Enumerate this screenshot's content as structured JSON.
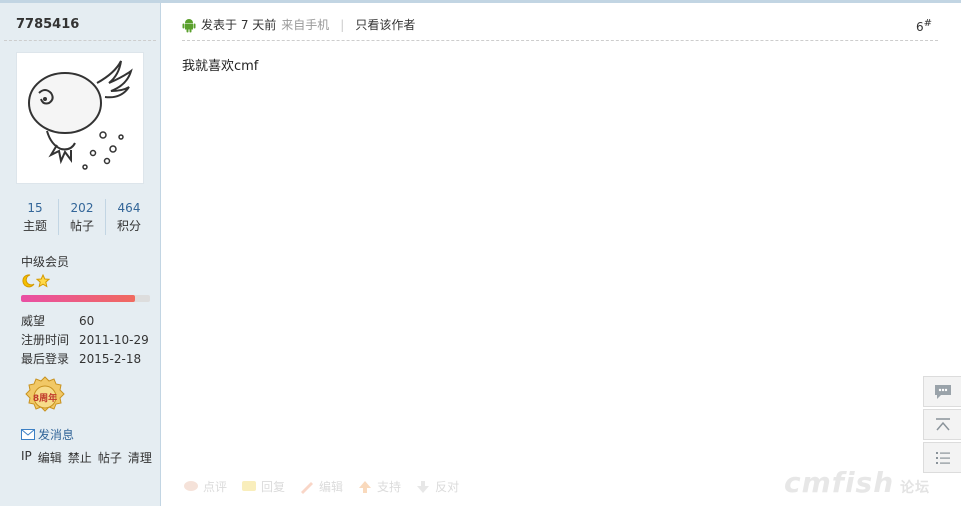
{
  "user": {
    "name": "7785416",
    "stats": [
      {
        "num": "15",
        "label": "主题"
      },
      {
        "num": "202",
        "label": "帖子"
      },
      {
        "num": "464",
        "label": "积分"
      }
    ],
    "group": "中级会员",
    "progress": 0.88,
    "info": [
      {
        "k": "威望",
        "v": "60"
      },
      {
        "k": "注册时间",
        "v": "2011-10-29"
      },
      {
        "k": "最后登录",
        "v": "2015-2-18"
      }
    ],
    "medal_text": "8周年",
    "send_message": "发消息",
    "admin_links": [
      "IP",
      "编辑",
      "禁止",
      "帖子",
      "清理"
    ]
  },
  "post": {
    "posted": "发表于 7 天前",
    "source": "来自手机",
    "only_author": "只看该作者",
    "floor": "6",
    "floor_mark": "#",
    "body": "我就喜欢cmf"
  },
  "actions": [
    "点评",
    "回复",
    "编辑",
    "支持",
    "反对"
  ],
  "watermark": "cmfish",
  "watermark_small": "论坛"
}
